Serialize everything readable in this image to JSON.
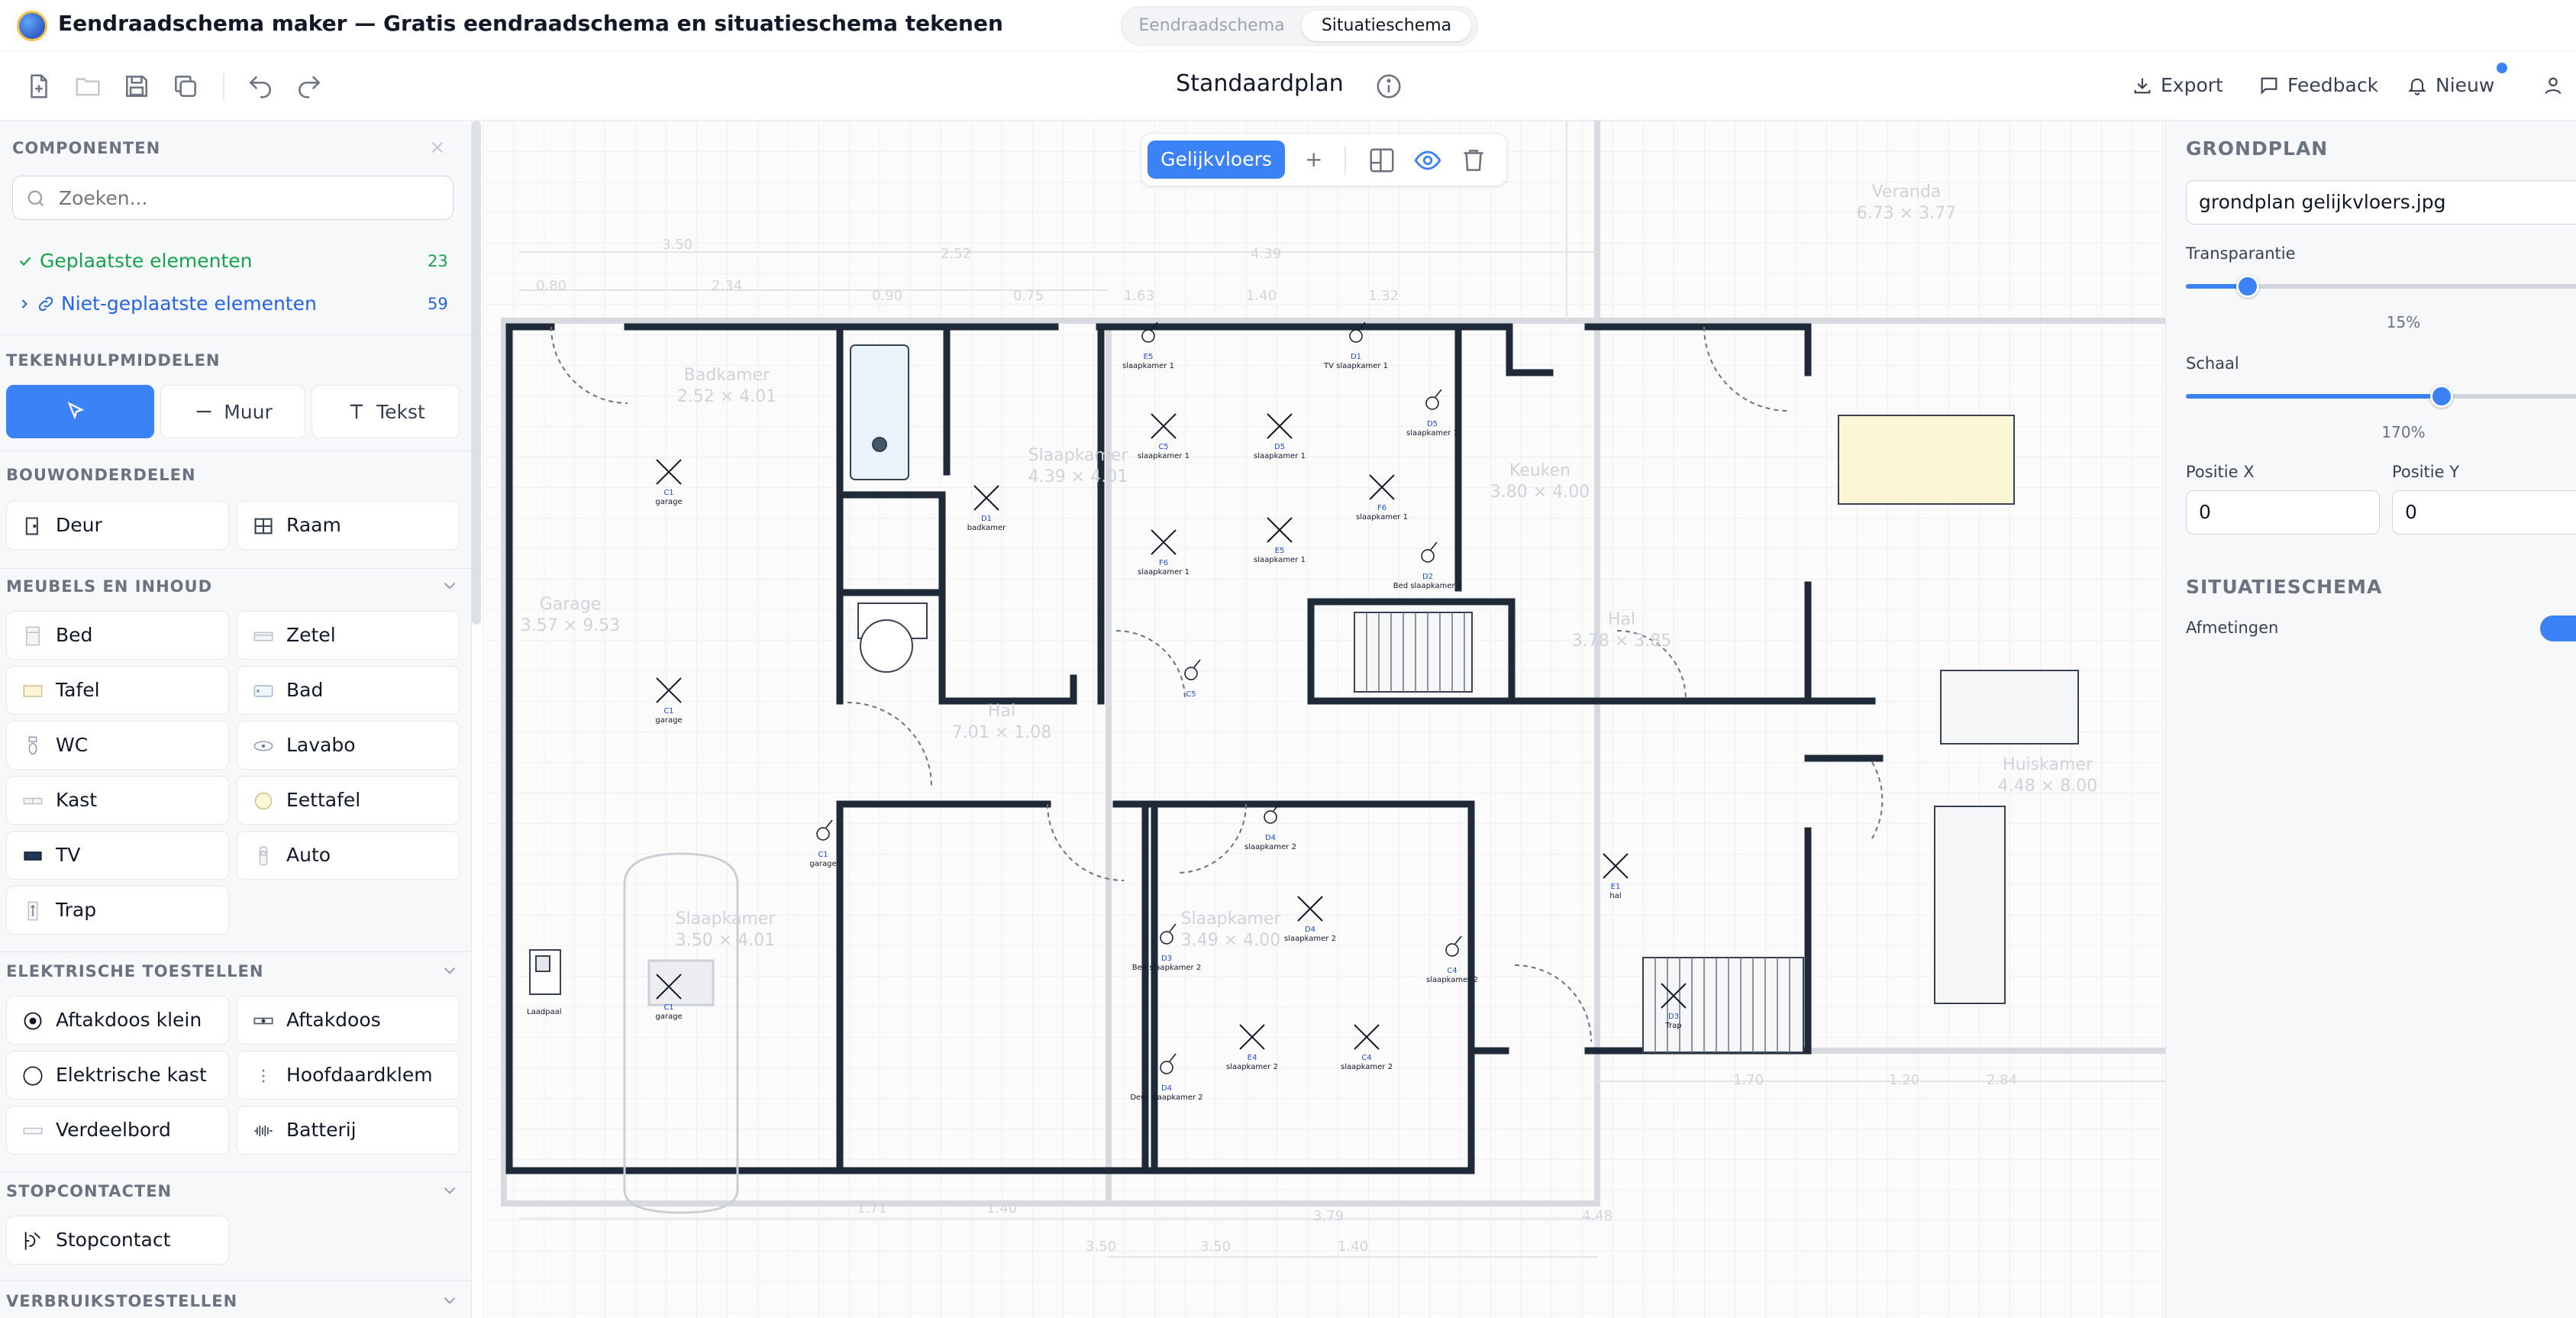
{
  "app": {
    "title": "Eendraadschema maker — Gratis eendraadschema en situatieschema tekenen",
    "modes": [
      "Eendraadschema",
      "Situatieschema"
    ],
    "active_mode": "Situatieschema"
  },
  "toolbar": {
    "plan_title": "Standaardplan",
    "export_label": "Export",
    "feedback_label": "Feedback",
    "new_label": "Nieuw",
    "icons": [
      "new-file-icon",
      "open-folder-icon",
      "save-icon",
      "duplicate-icon",
      "undo-icon",
      "redo-icon",
      "info-icon",
      "export-icon",
      "feedback-icon",
      "bell-icon",
      "user-icon"
    ]
  },
  "sidebar": {
    "title": "COMPONENTEN",
    "search_placeholder": "Zoeken...",
    "placed_label": "Geplaatste elementen",
    "placed_count": "23",
    "unplaced_label": "Niet-geplaatste elementen",
    "unplaced_count": "59",
    "tools_header": "TEKENHULPMIDDELEN",
    "tools": {
      "select": "",
      "wall": "Muur",
      "text": "Tekst"
    },
    "building_header": "BOUWONDERDELEN",
    "building": [
      "Deur",
      "Raam"
    ],
    "furniture_header": "MEUBELS EN INHOUD",
    "furniture": [
      "Bed",
      "Zetel",
      "Tafel",
      "Bad",
      "WC",
      "Lavabo",
      "Kast",
      "Eettafel",
      "TV",
      "Auto",
      "Trap"
    ],
    "electrical_header": "ELEKTRISCHE TOESTELLEN",
    "electrical": [
      "Aftakdoos klein",
      "Aftakdoos",
      "Elektrische kast",
      "Hoofdaardklem",
      "Verdeelbord",
      "Batterij"
    ],
    "sockets_header": "STOPCONTACTEN",
    "sockets": [
      "Stopcontact"
    ],
    "consumers_header": "VERBRUIKSTOESTELLEN"
  },
  "canvas": {
    "floor_tab": "Gelijkvloers",
    "add_floor": "+",
    "rooms": [
      {
        "name": "Garage",
        "dims": "3.57 × 9.53"
      },
      {
        "name": "Badkamer",
        "dims": "2.52 × 4.01"
      },
      {
        "name": "Slaapkamer",
        "dims": "4.39 × 4.01"
      },
      {
        "name": "Keuken",
        "dims": "3.80 × 4.00"
      },
      {
        "name": "Veranda",
        "dims": "6.73 × 3.77"
      },
      {
        "name": "Hal",
        "dims": "7.01 × 1.08"
      },
      {
        "name": "Hal",
        "dims": "3.78 × 3.85"
      },
      {
        "name": "Huiskamer",
        "dims": "4.48 × 8.00"
      },
      {
        "name": "Slaapkamer",
        "dims": "3.50 × 4.01"
      },
      {
        "name": "Slaapkamer",
        "dims": "3.49 × 4.00"
      }
    ],
    "dimension_labels": [
      "3.50",
      "2.52",
      "4.39",
      "0.80",
      "2.34",
      "0.90",
      "0.75",
      "1.63",
      "1.40",
      "1.32",
      "1.70",
      "1.20",
      "2.84",
      "3.79",
      "4.48",
      "1.71",
      "1.40",
      "3.50",
      "3.50",
      "1.40"
    ],
    "symbols": [
      {
        "code": "C1",
        "label": "garage"
      },
      {
        "code": "C1",
        "label": "garage"
      },
      {
        "code": "C1",
        "label": "garage"
      },
      {
        "code": "C1",
        "label": "garage"
      },
      {
        "code": "D1",
        "label": "badkamer"
      },
      {
        "code": "E5",
        "label": "slaapkamer 1"
      },
      {
        "code": "D1",
        "label": "TV slaapkamer 1"
      },
      {
        "code": "C5",
        "label": "slaapkamer 1"
      },
      {
        "code": "D5",
        "label": "slaapkamer 1"
      },
      {
        "code": "D5",
        "label": "slaapkamer 1"
      },
      {
        "code": "F6",
        "label": "slaapkamer 1"
      },
      {
        "code": "F6",
        "label": "slaapkamer 1"
      },
      {
        "code": "E5",
        "label": "slaapkamer 1"
      },
      {
        "code": "D2",
        "label": "Bed slaapkamer 1"
      },
      {
        "code": "C5",
        "label": ""
      },
      {
        "code": "D4",
        "label": "slaapkamer 2"
      },
      {
        "code": "D4",
        "label": "slaapkamer 2"
      },
      {
        "code": "D3",
        "label": "Bed slaapkamer 2"
      },
      {
        "code": "C4",
        "label": "slaapkamer 2"
      },
      {
        "code": "E4",
        "label": "slaapkamer 2"
      },
      {
        "code": "C4",
        "label": "slaapkamer 2"
      },
      {
        "code": "D4",
        "label": "Deur slaapkamer 2"
      },
      {
        "code": "E1",
        "label": "hal"
      },
      {
        "code": "D3",
        "label": "Trap"
      }
    ],
    "ev_charger_label": "Laadpaal"
  },
  "rightpanel": {
    "grondplan_header": "GRONDPLAN",
    "file_name": "grondplan gelijkvloers.jpg",
    "transparency_label": "Transparantie",
    "transparency_value": "15%",
    "transparency_fraction": 0.15,
    "scale_label": "Schaal",
    "scale_value": "170%",
    "scale_fraction": 0.62,
    "pos_x_label": "Positie X",
    "pos_x_value": "0",
    "pos_y_label": "Positie Y",
    "pos_y_value": "0",
    "situatie_header": "SITUATIESCHEMA",
    "dimensions_label": "Afmetingen",
    "dimensions_on": true
  },
  "colors": {
    "accent": "#3b82f6",
    "placed": "#16a34a",
    "unplaced": "#2563eb",
    "wall": "#1f2937"
  }
}
